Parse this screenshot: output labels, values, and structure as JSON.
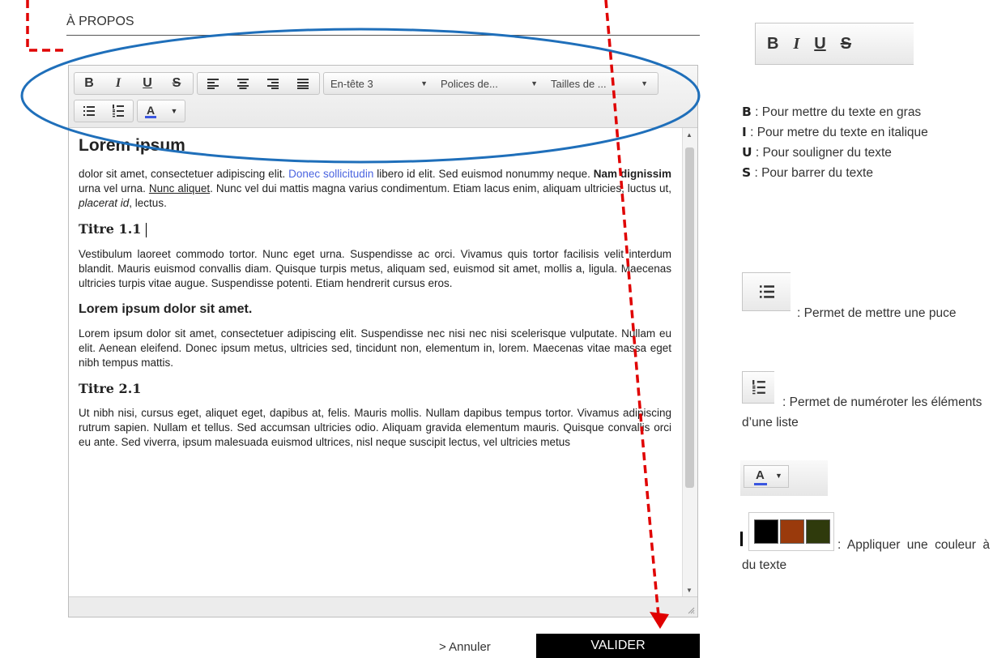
{
  "section": {
    "title": "À PROPOS"
  },
  "toolbar": {
    "bold": "B",
    "italic": "I",
    "underline": "U",
    "strike": "S",
    "heading": "En-tête 3",
    "font": "Polices de...",
    "size": "Tailles de ...",
    "color_letter": "A"
  },
  "content": {
    "h1": "Lorem ipsum",
    "p1": {
      "a": "  dolor sit amet, consectetuer adipiscing elit. ",
      "link": "Donec sollicitudin",
      "b": " libero id elit. Sed euismod nonummy neque. ",
      "bold": "Nam dignissim",
      "c": " urna vel urna. ",
      "under": "Nunc aliquet",
      "d": ". Nunc vel dui mattis magna varius condimentum. Etiam lacus enim, aliquam ultricies, luctus ut, ",
      "ital": "placerat id",
      "e": ", lectus."
    },
    "t11": "Titre 1.1",
    "p2": "Vestibulum laoreet commodo tortor. Nunc eget urna. Suspendisse ac orci. Vivamus quis tortor facilisis velit interdum blandit. Mauris euismod convallis diam. Quisque turpis metus, aliquam sed, euismod sit amet, mollis a, ligula. Maecenas ultricies turpis vitae augue. Suspendisse potenti. Etiam hendrerit cursus eros.",
    "h2": "Lorem ipsum dolor sit amet.",
    "p3": "Lorem ipsum dolor sit amet, consectetuer adipiscing elit. Suspendisse nec nisi nec nisi scelerisque vulputate. Nullam eu elit. Aenean eleifend. Donec ipsum metus, ultricies sed, tincidunt non, elementum in, lorem. Maecenas vitae massa eget nibh tempus mattis.",
    "t21": "Titre 2.1",
    "p4": "Ut nibh nisi, cursus eget, aliquet eget, dapibus at, felis. Mauris mollis. Nullam dapibus tempus tortor. Vivamus adipiscing rutrum sapien. Nullam et tellus. Sed accumsan ultricies odio. Aliquam gravida elementum mauris. Quisque convallis orci eu ante. Sed viverra, ipsum malesuada euismod ultrices, nisl neque suscipit lectus, vel ultricies metus"
  },
  "actions": {
    "cancel": "> Annuler",
    "validate": "VALIDER"
  },
  "help": {
    "b_key": "B",
    "b_text": " : Pour mettre du texte en gras",
    "i_key": "I",
    "i_text": " :  Pour  metre  du  texte  en italique",
    "u_key": "U",
    "u_text": " : Pour souligner du texte",
    "s_key": "S",
    "s_text": " : Pour barrer du texte",
    "bullet_text": ":  Permet  de  mettre  une puce",
    "number_text": ": Permet de numéroter les éléments d’une liste",
    "color_text": ":      Appliquer      une couleur à du texte"
  },
  "colors": {
    "annotation_blue": "#1f6fba",
    "arrow_red": "#e00000",
    "link": "#4a64e0",
    "underline_blue": "#3a56e0",
    "swatch_1": "#000000",
    "swatch_2": "#9a3a0c",
    "swatch_3": "#2f3a0c"
  }
}
